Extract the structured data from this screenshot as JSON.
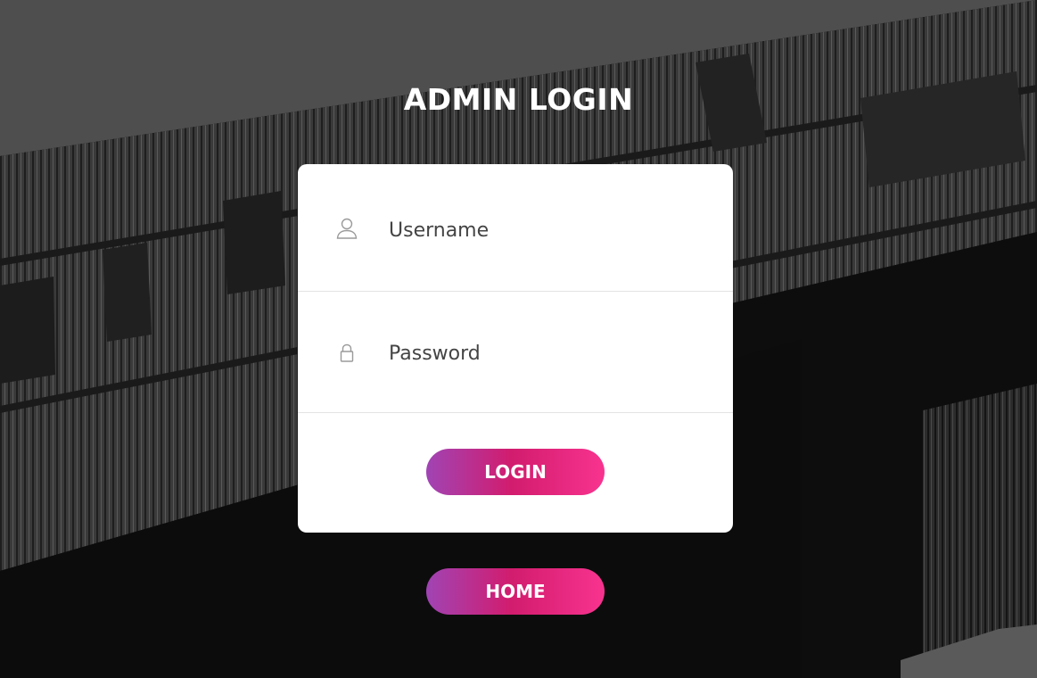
{
  "page": {
    "title": "ADMIN LOGIN"
  },
  "form": {
    "username": {
      "placeholder": "Username",
      "value": "",
      "icon": "user-icon"
    },
    "password": {
      "placeholder": "Password",
      "value": "",
      "icon": "lock-icon"
    },
    "login_label": "LOGIN"
  },
  "nav": {
    "home_label": "HOME"
  },
  "colors": {
    "button_gradient_start": "#a044b4",
    "button_gradient_mid": "#d21c6e",
    "button_gradient_end": "#f8338f",
    "card_background": "#ffffff",
    "title_color": "#ffffff"
  }
}
